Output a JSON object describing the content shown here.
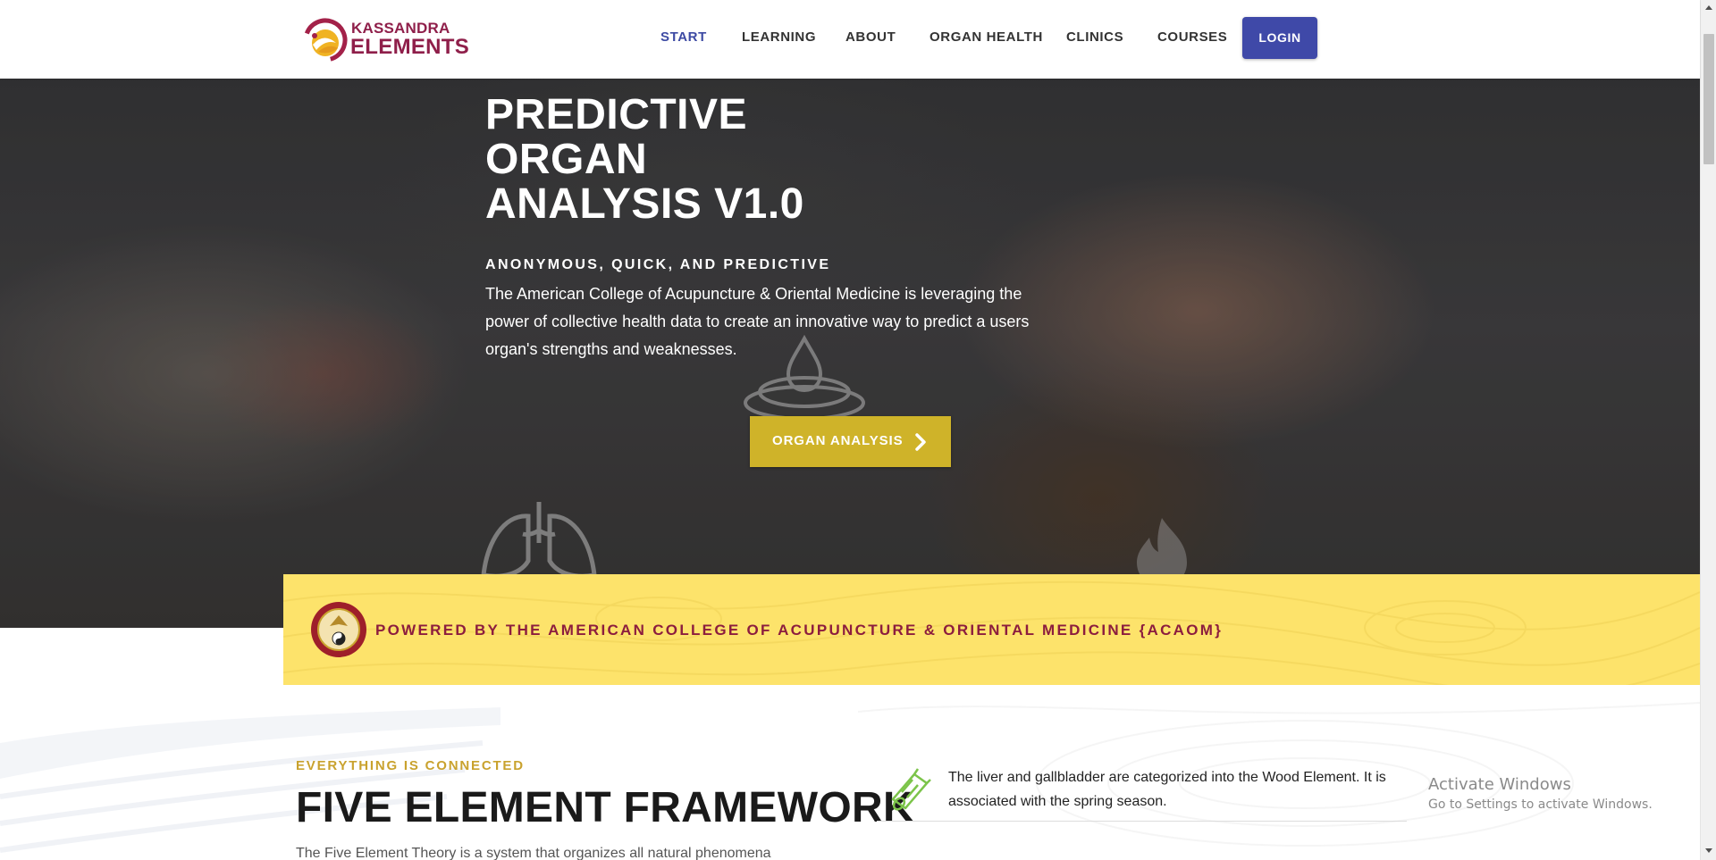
{
  "header": {
    "logo_line1": "KASSANDRA",
    "logo_line2": "ELEMENTS",
    "nav": [
      "START",
      "LEARNING",
      "ABOUT",
      "ORGAN HEALTH",
      "CLINICS",
      "COURSES"
    ],
    "active_nav": "START",
    "login_label": "LOGIN"
  },
  "hero": {
    "title_lines": [
      "PREDICTIVE",
      "ORGAN",
      "ANALYSIS V1.0"
    ],
    "subtitle": "ANONYMOUS, QUICK, AND PREDICTIVE",
    "description": "The American College of Acupuncture & Oriental Medicine is leveraging the power of collective health data to create an innovative way to predict a users organ's strengths and weaknesses.",
    "cta_label": "ORGAN ANALYSIS",
    "cta_icon": "chevron-right-icon"
  },
  "banner": {
    "text": "POWERED BY THE AMERICAN COLLEGE OF ACUPUNCTURE & ORIENTAL MEDICINE {ACAOM}"
  },
  "section": {
    "eyebrow": "EVERYTHING IS CONNECTED",
    "title": "FIVE ELEMENT FRAMEWORK",
    "body": "The Five Element Theory is a system that organizes all natural phenomena",
    "elements": [
      {
        "icon": "wood-log-icon",
        "text": "The liver and gallbladder are categorized into the Wood Element. It is associated with the spring season."
      }
    ]
  },
  "watermark": {
    "line1": "Activate Windows",
    "line2": "Go to Settings to activate Windows."
  },
  "colors": {
    "brand": "#8f1f4a",
    "nav_active": "#3d4aa3",
    "login_bg": "#3f49a8",
    "cta_bg": "#cfb329",
    "banner_bg": "#fde36b",
    "banner_text": "#8c1d3e",
    "eyebrow": "#c9a22e",
    "wood_icon": "#7cc44a"
  }
}
